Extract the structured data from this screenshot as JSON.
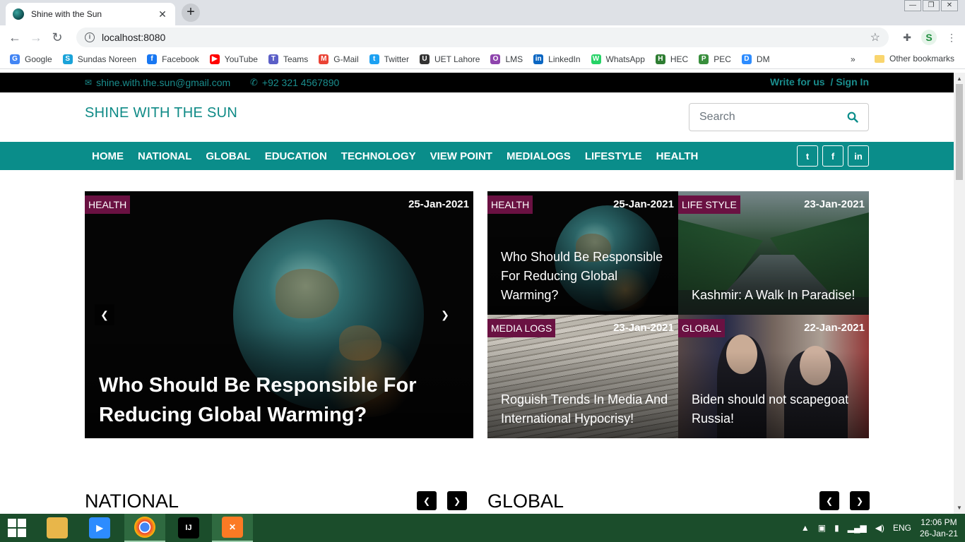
{
  "browser": {
    "tab_title": "Shine with the Sun",
    "tab_close": "✕",
    "new_tab": "+",
    "url": "localhost:8080",
    "profile_initial": "S",
    "bookmarks": [
      {
        "label": "Google",
        "icon": "G",
        "color": "#4285f4"
      },
      {
        "label": "Sundas Noreen",
        "icon": "S",
        "color": "#1aa3d9"
      },
      {
        "label": "Facebook",
        "icon": "f",
        "color": "#1877f2"
      },
      {
        "label": "YouTube",
        "icon": "▶",
        "color": "#ff0000"
      },
      {
        "label": "Teams",
        "icon": "T",
        "color": "#5b5fc7"
      },
      {
        "label": "G-Mail",
        "icon": "M",
        "color": "#ea4335"
      },
      {
        "label": "Twitter",
        "icon": "t",
        "color": "#1da1f2"
      },
      {
        "label": "UET Lahore",
        "icon": "U",
        "color": "#333333"
      },
      {
        "label": "LMS",
        "icon": "O",
        "color": "#8e44ad"
      },
      {
        "label": "LinkedIn",
        "icon": "in",
        "color": "#0a66c2"
      },
      {
        "label": "WhatsApp",
        "icon": "W",
        "color": "#25d366"
      },
      {
        "label": "HEC",
        "icon": "H",
        "color": "#2e7d32"
      },
      {
        "label": "PEC",
        "icon": "P",
        "color": "#388e3c"
      },
      {
        "label": "DM",
        "icon": "D",
        "color": "#2d8cff"
      }
    ],
    "bookmarks_more": "»",
    "other_bookmarks": "Other bookmarks"
  },
  "site": {
    "email": "shine.with.the.sun@gmail.com",
    "phone": "+92 321 4567890",
    "write_for_us": "Write for us",
    "sign_in_sep": "/",
    "sign_in": "Sign In",
    "brand": "SHINE WITH THE SUN",
    "search_placeholder": "Search",
    "nav": [
      "HOME",
      "NATIONAL",
      "GLOBAL",
      "EDUCATION",
      "TECHNOLOGY",
      "VIEW POINT",
      "MEDIALOGS",
      "LIFESTYLE",
      "HEALTH"
    ],
    "social": [
      "twitter-icon",
      "facebook-icon",
      "linkedin-icon"
    ],
    "accent_color": "#0a8d8a",
    "badge_color": "#6a1142"
  },
  "hero": {
    "category": "HEALTH",
    "date": "25-Jan-2021",
    "title": "Who Should Be Responsible For Reducing Global Warming?"
  },
  "cards": [
    {
      "category": "HEALTH",
      "date": "25-Jan-2021",
      "title": "Who Should Be Responsible For Reducing Global Warming?"
    },
    {
      "category": "LIFE STYLE",
      "date": "23-Jan-2021",
      "title": "Kashmir: A Walk In Paradise!"
    },
    {
      "category": "MEDIA LOGS",
      "date": "23-Jan-2021",
      "title": "Roguish Trends In Media And International Hypocrisy!"
    },
    {
      "category": "GLOBAL",
      "date": "22-Jan-2021",
      "title": "Biden should not scapegoat Russia!"
    }
  ],
  "sections": {
    "national": "NATIONAL",
    "global": "GLOBAL"
  },
  "taskbar": {
    "language": "ENG",
    "time": "12:06 PM",
    "date": "26-Jan-21"
  }
}
